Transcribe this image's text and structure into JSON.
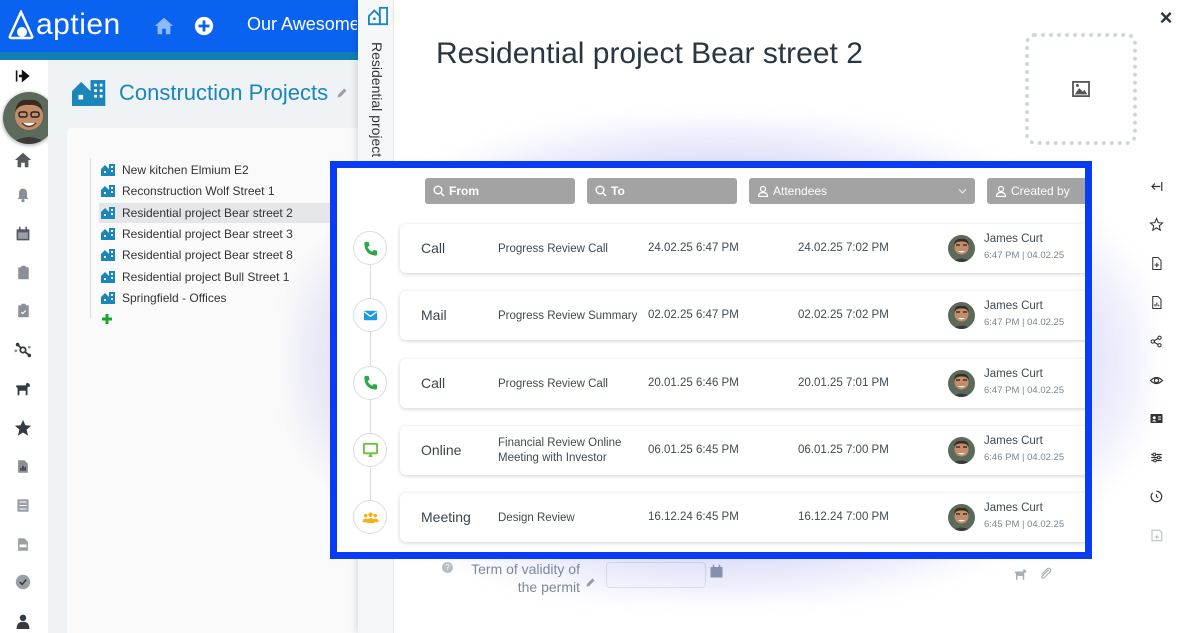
{
  "topbar": {
    "logo_text": "aptien",
    "title": "Our Awesome",
    "icons": [
      "home-icon",
      "plus-circle-icon"
    ]
  },
  "left_rail": {
    "icons": [
      "collapse-arrow-icon",
      "home-icon",
      "bell-icon",
      "calendar-icon",
      "clipboard-icon",
      "clipboard-check-icon",
      "network-icon",
      "dog-icon",
      "star-icon",
      "report-icon",
      "checklist-icon",
      "document-icon",
      "check-circle-icon",
      "user-icon"
    ]
  },
  "module": {
    "title": "Construction Projects",
    "tree_items": [
      {
        "label": "New kitchen Elmium E2",
        "selected": false
      },
      {
        "label": "Reconstruction Wolf Street 1",
        "selected": false
      },
      {
        "label": "Residential project Bear street 2",
        "selected": true
      },
      {
        "label": "Residential project Bear street 3",
        "selected": false
      },
      {
        "label": "Residential project Bear street 8",
        "selected": false
      },
      {
        "label": "Residential project Bull Street 1",
        "selected": false
      },
      {
        "label": "Springfield - Offices",
        "selected": false
      }
    ],
    "add_label": "+"
  },
  "detail": {
    "vertical_tab": "Residential project",
    "title": "Residential project Bear street 2",
    "close_label": "×",
    "permit_field": {
      "label": "Term of validity of the permit",
      "value": ""
    }
  },
  "right_rail": {
    "icons": [
      "collapse-left-icon",
      "star-outline-icon",
      "file-add-icon",
      "file-chart-icon",
      "share-icon",
      "eye-icon",
      "id-card-icon",
      "sliders-icon",
      "history-icon",
      "save-icon"
    ]
  },
  "activities": {
    "filters": {
      "from": "From",
      "to": "To",
      "attendees": "Attendees",
      "created_by": "Created by"
    },
    "rows": [
      {
        "type": "Call",
        "icon": "phone-icon",
        "icon_color": "#2aa84a",
        "subject": "Progress Review Call",
        "from": "24.02.25 6:47 PM",
        "to": "24.02.25 7:02 PM",
        "creator": "James Curt",
        "created": "6:47 PM | 04.02.25"
      },
      {
        "type": "Mail",
        "icon": "mail-icon",
        "icon_color": "#1a9be8",
        "subject": "Progress Review Summary",
        "from": "02.02.25 6:47 PM",
        "to": "02.02.25 7:02 PM",
        "creator": "James Curt",
        "created": "6:47 PM | 04.02.25"
      },
      {
        "type": "Call",
        "icon": "phone-icon",
        "icon_color": "#2aa84a",
        "subject": "Progress Review Call",
        "from": "20.01.25 6:46 PM",
        "to": "20.01.25 7:01 PM",
        "creator": "James Curt",
        "created": "6:47 PM | 04.02.25"
      },
      {
        "type": "Online",
        "icon": "monitor-icon",
        "icon_color": "#6bbf3a",
        "subject": "Financial Review Online Meeting with Investor",
        "from": "06.01.25 6:45 PM",
        "to": "06.01.25 7:00 PM",
        "creator": "James Curt",
        "created": "6:46 PM | 04.02.25"
      },
      {
        "type": "Meeting",
        "icon": "people-icon",
        "icon_color": "#f2b21c",
        "subject": "Design Review",
        "from": "16.12.24 6:45 PM",
        "to": "16.12.24 7:00 PM",
        "creator": "James Curt",
        "created": "6:45 PM | 04.02.25"
      }
    ]
  },
  "colors": {
    "brand_blue": "#0a63f0",
    "accent_teal": "#1b86b9",
    "modal_border": "#0a3cf5"
  }
}
